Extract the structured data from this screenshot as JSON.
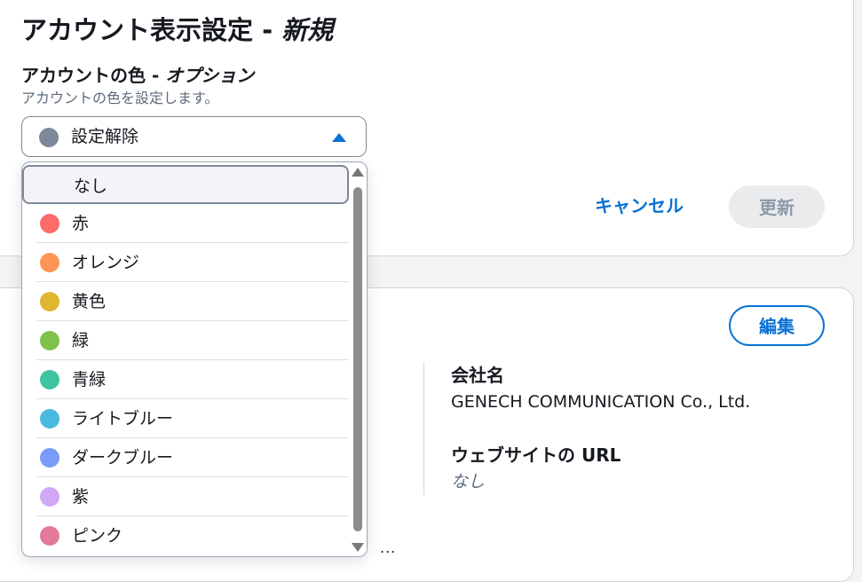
{
  "top_card": {
    "title": "アカウント表示設定 - ",
    "title_emphasis": "新規",
    "field_label": "アカウントの色 - ",
    "field_label_emphasis": "オプション",
    "field_description": "アカウントの色を設定します。",
    "select": {
      "value": "設定解除",
      "dot_color": "#7d8998",
      "expanded": true
    },
    "options": [
      {
        "label": "なし",
        "color": null,
        "highlighted": true
      },
      {
        "label": "赤",
        "color": "#ff6b6b"
      },
      {
        "label": "オレンジ",
        "color": "#fe9556"
      },
      {
        "label": "黄色",
        "color": "#e0b530"
      },
      {
        "label": "緑",
        "color": "#7dc24b"
      },
      {
        "label": "青緑",
        "color": "#3fc3a1"
      },
      {
        "label": "ライトブルー",
        "color": "#49b9e0"
      },
      {
        "label": "ダークブルー",
        "color": "#7b9bfb"
      },
      {
        "label": "紫",
        "color": "#d0a8f5"
      },
      {
        "label": "ピンク",
        "color": "#e27a98"
      }
    ],
    "cancel_label": "キャンセル",
    "update_label": "更新"
  },
  "bottom_card": {
    "edit_label": "編集",
    "company_name_label": "会社名",
    "company_name_value": "GENECH COMMUNICATION Co., Ltd.",
    "website_label": "ウェブサイトの URL",
    "website_value": "なし",
    "truncated_text": "..."
  },
  "colors": {
    "accent": "#0972d3",
    "disabled_bg": "#e9ebed",
    "disabled_text": "#8d99a8",
    "secondary_text": "#5f6b7a"
  }
}
